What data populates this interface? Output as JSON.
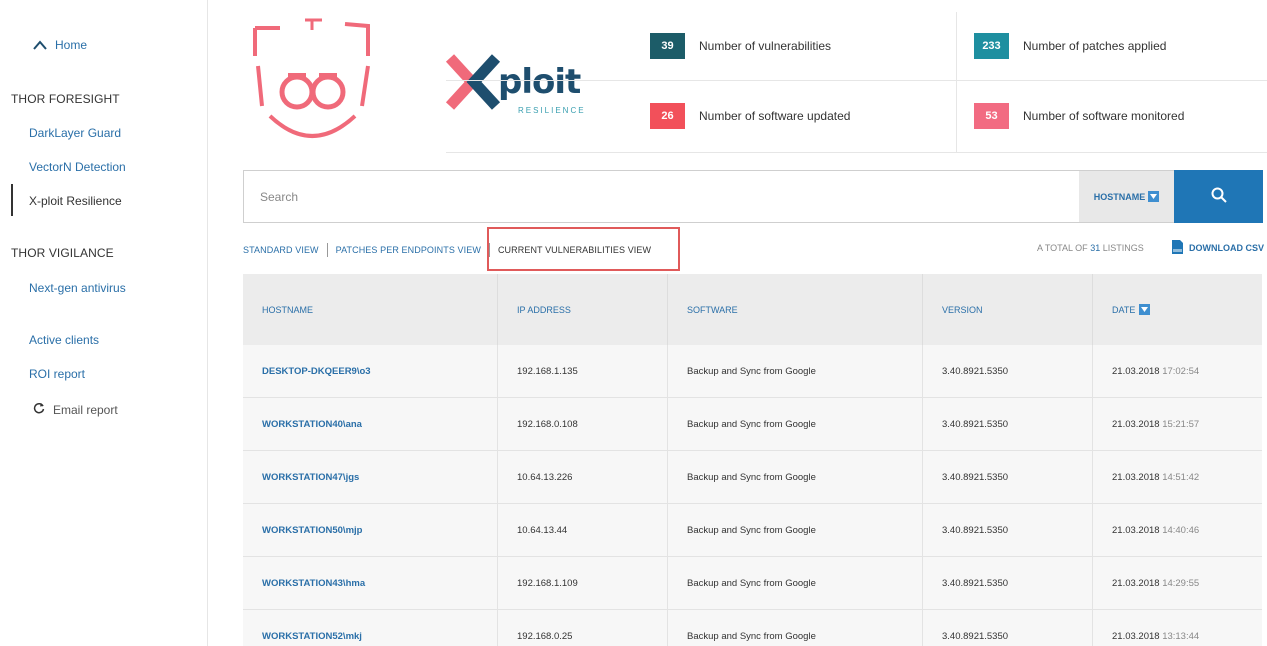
{
  "sidebar": {
    "home": "Home",
    "section1": "THOR FORESIGHT",
    "items1": [
      "DarkLayer Guard",
      "VectorN Detection",
      "X-ploit Resilience"
    ],
    "section2": "THOR VIGILANCE",
    "items2": [
      "Next-gen antivirus"
    ],
    "items3": [
      "Active clients",
      "ROI report"
    ],
    "email": "Email report"
  },
  "logo": {
    "word": "ploit",
    "sub": "RESILIENCE",
    "colors": {
      "pink": "#f06a7a",
      "navy": "#1e4e6e",
      "teal": "#3a9fb0"
    }
  },
  "stats": [
    {
      "value": "39",
      "label": "Number of vulnerabilities",
      "color": "#1c5c68"
    },
    {
      "value": "233",
      "label": "Number of patches applied",
      "color": "#1e8fa0"
    },
    {
      "value": "26",
      "label": "Number of software updated",
      "color": "#f2505a"
    },
    {
      "value": "53",
      "label": "Number of software monitored",
      "color": "#f26b82"
    }
  ],
  "search": {
    "placeholder": "Search",
    "filter": "HOSTNAME"
  },
  "views": {
    "standard": "STANDARD VIEW",
    "patches": "PATCHES PER ENDPOINTS VIEW",
    "current": "CURRENT VULNERABILITIES VIEW"
  },
  "listing": {
    "prefix": "A TOTAL OF",
    "count": "31",
    "suffix": "LISTINGS"
  },
  "csv": "DOWNLOAD CSV",
  "table": {
    "headers": [
      "HOSTNAME",
      "IP ADDRESS",
      "SOFTWARE",
      "VERSION",
      "DATE"
    ],
    "rows": [
      {
        "host": "DESKTOP-DKQEER9\\o3",
        "ip": "192.168.1.135",
        "software": "Backup and Sync from Google",
        "version": "3.40.8921.5350",
        "date": "21.03.2018",
        "time": "17:02:54"
      },
      {
        "host": "WORKSTATION40\\ana",
        "ip": "192.168.0.108",
        "software": "Backup and Sync from Google",
        "version": "3.40.8921.5350",
        "date": "21.03.2018",
        "time": "15:21:57"
      },
      {
        "host": "WORKSTATION47\\jgs",
        "ip": "10.64.13.226",
        "software": "Backup and Sync from Google",
        "version": "3.40.8921.5350",
        "date": "21.03.2018",
        "time": "14:51:42"
      },
      {
        "host": "WORKSTATION50\\mjp",
        "ip": "10.64.13.44",
        "software": "Backup and Sync from Google",
        "version": "3.40.8921.5350",
        "date": "21.03.2018",
        "time": "14:40:46"
      },
      {
        "host": "WORKSTATION43\\hma",
        "ip": "192.168.1.109",
        "software": "Backup and Sync from Google",
        "version": "3.40.8921.5350",
        "date": "21.03.2018",
        "time": "14:29:55"
      },
      {
        "host": "WORKSTATION52\\mkj",
        "ip": "192.168.0.25",
        "software": "Backup and Sync from Google",
        "version": "3.40.8921.5350",
        "date": "21.03.2018",
        "time": "13:13:44"
      }
    ]
  }
}
